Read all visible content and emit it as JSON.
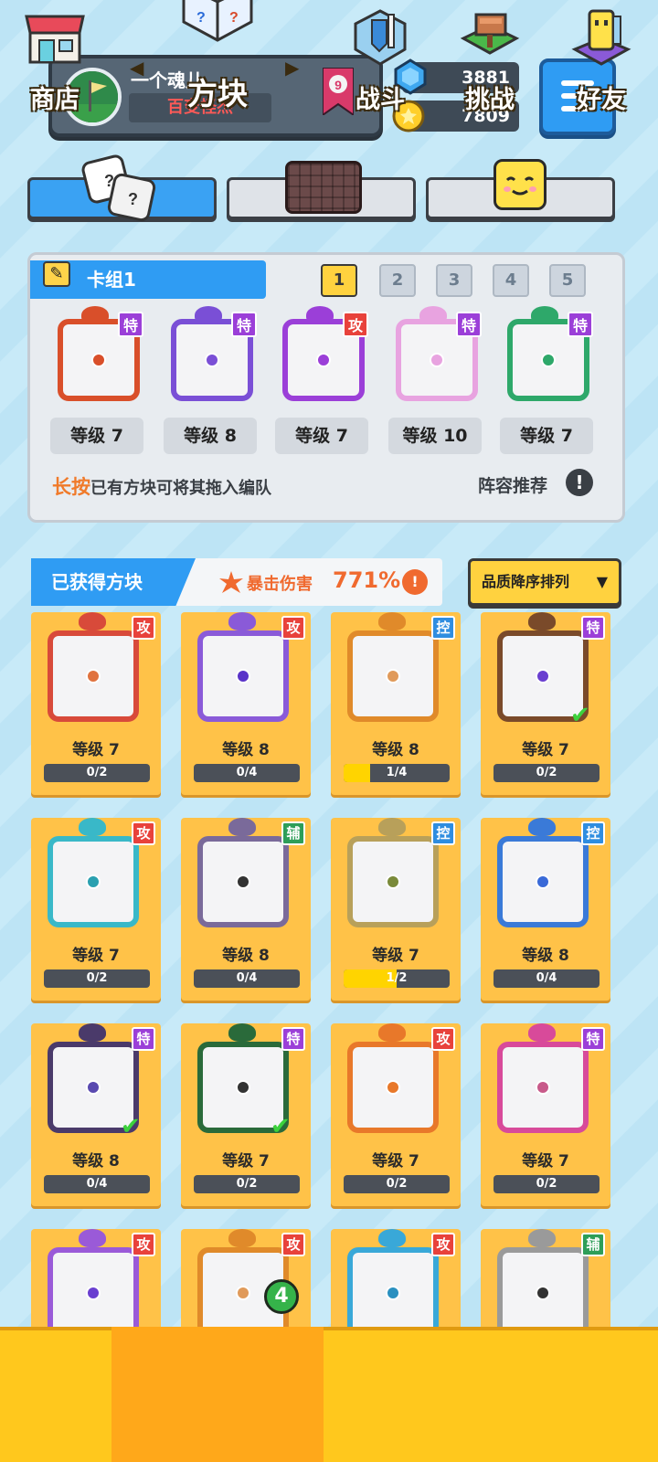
{
  "profile": {
    "name": "一个魂儿",
    "title": "百变怪杰",
    "rank": "9"
  },
  "currency": {
    "gems": "3881",
    "coins": "7809"
  },
  "deck": {
    "title": "卡组1",
    "tabs": [
      "1",
      "2",
      "3",
      "4",
      "5"
    ],
    "active_tab": "1",
    "cards": [
      {
        "tag": "特",
        "level": "等级 7",
        "color": "#d94f2a"
      },
      {
        "tag": "特",
        "level": "等级 8",
        "color": "#7a4fd6"
      },
      {
        "tag": "攻",
        "level": "等级 7",
        "color": "#9b3fd8"
      },
      {
        "tag": "特",
        "level": "等级 10",
        "color": "#e8a3e0"
      },
      {
        "tag": "特",
        "level": "等级 7",
        "color": "#2ea86a"
      }
    ],
    "hint_highlight": "长按",
    "hint_rest": "已有方块可将其拖入编队",
    "recommend": "阵容推荐"
  },
  "acquired": {
    "title": "已获得方块",
    "crit_label": "暴击伤害",
    "crit_value": "771%",
    "sort": "品质降序排列",
    "cards": [
      {
        "tag": "攻",
        "tc": "r",
        "level": "等级 7",
        "progress": "0/2",
        "fill": 0,
        "color": "#d84a3a",
        "dot": "#e0733f",
        "check": false
      },
      {
        "tag": "攻",
        "tc": "r",
        "level": "等级 8",
        "progress": "0/4",
        "fill": 0,
        "color": "#8a5ad8",
        "dot": "#5a33c8",
        "check": false
      },
      {
        "tag": "控",
        "tc": "b",
        "level": "等级 8",
        "progress": "1/4",
        "fill": 0.25,
        "color": "#e08a2a",
        "dot": "#e09a5a",
        "check": false
      },
      {
        "tag": "特",
        "tc": "p",
        "level": "等级 7",
        "progress": "0/2",
        "fill": 0,
        "color": "#7a4a2a",
        "dot": "#6a3fd0",
        "check": true
      },
      {
        "tag": "攻",
        "tc": "r",
        "level": "等级 7",
        "progress": "0/2",
        "fill": 0,
        "color": "#39b8c8",
        "dot": "#2aa0b0",
        "check": false
      },
      {
        "tag": "辅",
        "tc": "g",
        "level": "等级 8",
        "progress": "0/4",
        "fill": 0,
        "color": "#7a6a9a",
        "dot": "#333",
        "check": false
      },
      {
        "tag": "控",
        "tc": "b",
        "level": "等级 7",
        "progress": "1/2",
        "fill": 0.5,
        "color": "#b8a05a",
        "dot": "#7a8a3a",
        "check": false
      },
      {
        "tag": "控",
        "tc": "b",
        "level": "等级 8",
        "progress": "0/4",
        "fill": 0,
        "color": "#3a7ad8",
        "dot": "#3a6ad8",
        "check": false
      },
      {
        "tag": "特",
        "tc": "p",
        "level": "等级 8",
        "progress": "0/4",
        "fill": 0,
        "color": "#4a3a6a",
        "dot": "#5a4ab0",
        "check": true
      },
      {
        "tag": "特",
        "tc": "p",
        "level": "等级 7",
        "progress": "0/2",
        "fill": 0,
        "color": "#2a6a3a",
        "dot": "#333",
        "check": true
      },
      {
        "tag": "攻",
        "tc": "r",
        "level": "等级 7",
        "progress": "0/2",
        "fill": 0,
        "color": "#e8782a",
        "dot": "#e8782a",
        "check": false
      },
      {
        "tag": "特",
        "tc": "p",
        "level": "等级 7",
        "progress": "0/2",
        "fill": 0,
        "color": "#d84a9a",
        "dot": "#c85a8a",
        "check": false
      },
      {
        "tag": "攻",
        "tc": "r",
        "level": "",
        "progress": "",
        "fill": 0,
        "color": "#9a5ad8",
        "dot": "#6a3fd0",
        "check": false
      },
      {
        "tag": "攻",
        "tc": "r",
        "level": "",
        "progress": "",
        "fill": 0,
        "color": "#e08a2a",
        "dot": "#e09a5a",
        "check": false
      },
      {
        "tag": "攻",
        "tc": "r",
        "level": "",
        "progress": "",
        "fill": 0,
        "color": "#39a8d8",
        "dot": "#2a90c0",
        "check": false
      },
      {
        "tag": "辅",
        "tc": "g",
        "level": "",
        "progress": "",
        "fill": 0,
        "color": "#9a9a9a",
        "dot": "#333",
        "check": false
      }
    ]
  },
  "nav": {
    "shop": "商店",
    "blocks": "方块",
    "battle": "战斗",
    "challenge": "挑战",
    "friends": "好友",
    "badge": "4"
  }
}
